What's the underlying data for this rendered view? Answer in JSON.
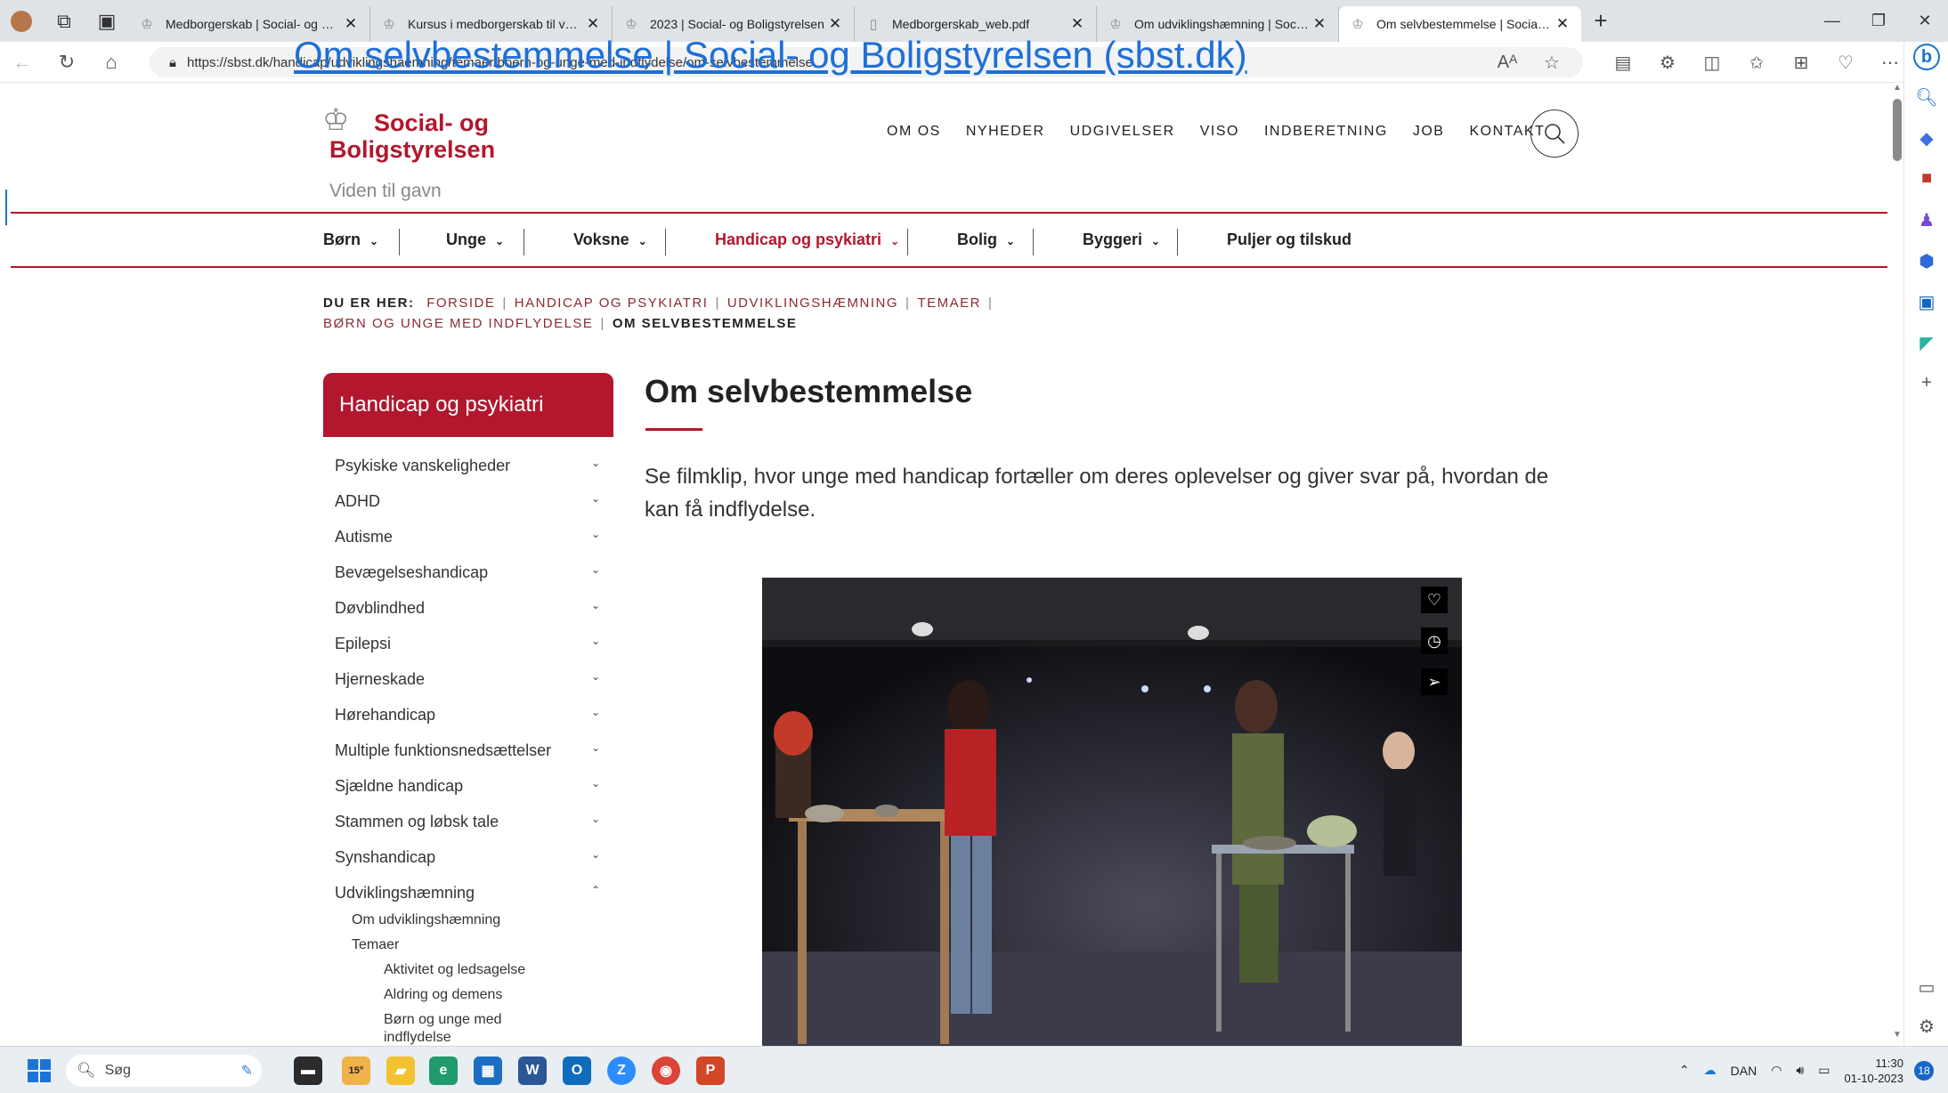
{
  "browser": {
    "tabs": [
      {
        "title": "Medborgerskab | Social- og Bolig"
      },
      {
        "title": "Kursus i medborgerskab til voksn"
      },
      {
        "title": "2023 | Social- og Boligstyrelsen"
      },
      {
        "title": "Medborgerskab_web.pdf"
      },
      {
        "title": "Om udviklingshæmning | Social-"
      },
      {
        "title": "Om selvbestemmelse | Social- og"
      }
    ],
    "url": "https://sbst.dk/handicap/udviklingshaemning/temaer/boern-og-unge-med-indflydelse/om-selvbestemmelse",
    "link_overlay": "Om selvbestemmelse | Social- og Boligstyrelsen (sbst.dk)"
  },
  "site": {
    "logo_line1": "Social- og",
    "logo_line2": "Boligstyrelsen",
    "tagline": "Viden til gavn",
    "top_nav": [
      "OM OS",
      "NYHEDER",
      "UDGIVELSER",
      "VISO",
      "INDBERETNING",
      "JOB",
      "KONTAKT"
    ],
    "main_nav": [
      "Børn",
      "Unge",
      "Voksne",
      "Handicap og psykiatri",
      "Bolig",
      "Byggeri",
      "Puljer og tilskud"
    ],
    "main_nav_active": "Handicap og psykiatri",
    "accent_color": "#b3172d"
  },
  "breadcrumb": {
    "label": "DU ER HER:",
    "items": [
      "FORSIDE",
      "HANDICAP OG PSYKIATRI",
      "UDVIKLINGSHÆMNING",
      "TEMAER",
      "BØRN OG UNGE MED INDFLYDELSE"
    ],
    "current": "OM SELVBESTEMMELSE"
  },
  "sidebar": {
    "heading": "Handicap og psykiatri",
    "items": [
      {
        "label": "Psykiske vanskeligheder"
      },
      {
        "label": "ADHD"
      },
      {
        "label": "Autisme"
      },
      {
        "label": "Bevægelseshandicap"
      },
      {
        "label": "Døvblindhed"
      },
      {
        "label": "Epilepsi"
      },
      {
        "label": "Hjerneskade"
      },
      {
        "label": "Hørehandicap"
      },
      {
        "label": "Multiple funktionsnedsættelser"
      },
      {
        "label": "Sjældne handicap"
      },
      {
        "label": "Stammen og løbsk tale"
      },
      {
        "label": "Synshandicap"
      },
      {
        "label": "Udviklingshæmning"
      }
    ],
    "sub_items": [
      "Om udviklingshæmning",
      "Temaer"
    ],
    "sub_sub_items": [
      "Aktivitet og ledsagelse",
      "Aldring og demens",
      "Børn og unge med indflydelse"
    ]
  },
  "main": {
    "title": "Om selvbestemmelse",
    "lead": "Se filmklip, hvor unge med handicap fortæller om deres oplevelser og giver svar på, hvordan de kan få indflydelse."
  },
  "taskbar": {
    "search_placeholder": "Søg",
    "weather": "15°",
    "language": "DAN",
    "time": "11:30",
    "date": "01-10-2023",
    "notifications": "18"
  }
}
